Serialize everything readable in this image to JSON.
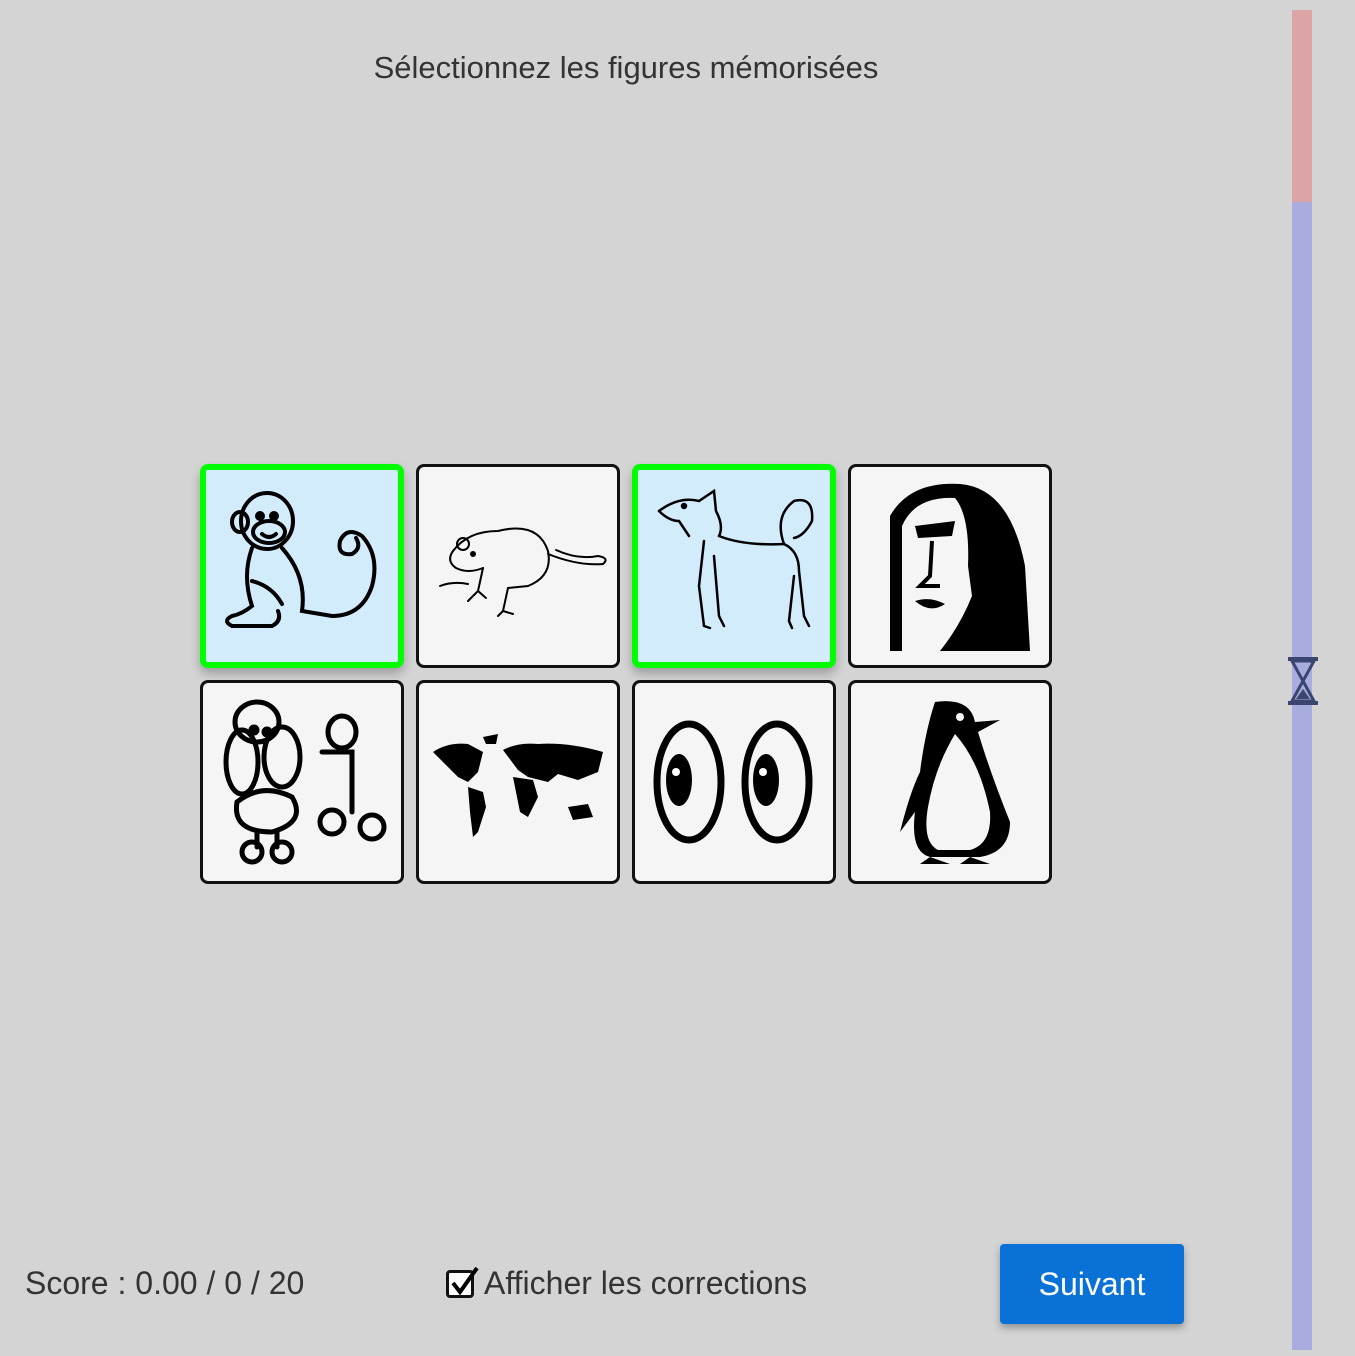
{
  "instruction": "Sélectionnez les figures mémorisées",
  "tiles": [
    {
      "icon": "monkey-icon",
      "selected": true
    },
    {
      "icon": "rat-icon",
      "selected": false
    },
    {
      "icon": "dog-icon",
      "selected": true
    },
    {
      "icon": "face-icon",
      "selected": false
    },
    {
      "icon": "poodle-icon",
      "selected": false
    },
    {
      "icon": "world-map-icon",
      "selected": false
    },
    {
      "icon": "eyes-icon",
      "selected": false
    },
    {
      "icon": "penguin-icon",
      "selected": false
    }
  ],
  "footer": {
    "score_text": "Score : 0.00 / 0 / 20",
    "show_corrections_label": "Afficher les corrections",
    "show_corrections_checked": true,
    "next_label": "Suivant"
  },
  "timer": {
    "elapsed_fraction": 0.143,
    "icon": "hourglass-icon"
  },
  "colors": {
    "background": "#d4d4d4",
    "selected_border": "#00ff00",
    "selected_fill": "#d3ecfc",
    "button": "#0a72d7",
    "timer_elapsed": "#dda4a6",
    "timer_remaining": "#a8acdf"
  }
}
